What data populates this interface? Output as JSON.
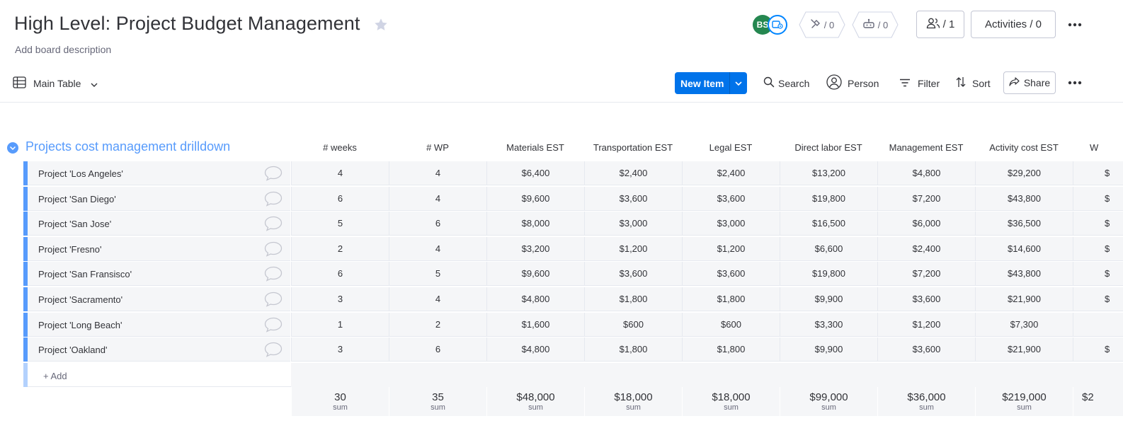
{
  "board": {
    "title": "High Level: Project Budget Management",
    "description": "Add board description"
  },
  "header": {
    "avatar_initials": "BS",
    "integrations_count": "/ 0",
    "automations_count": "/ 0",
    "members_label": "/ 1",
    "activities_label": "Activities / 0"
  },
  "toolbar": {
    "view_label": "Main Table",
    "new_item_label": "New Item",
    "search_label": "Search",
    "person_label": "Person",
    "filter_label": "Filter",
    "sort_label": "Sort",
    "share_label": "Share"
  },
  "group": {
    "title": "Projects cost management drilldown",
    "add_label": "+ Add",
    "sum_label": "sum"
  },
  "columns": [
    "# weeks",
    "# WP",
    "Materials EST",
    "Transportation EST",
    "Legal EST",
    "Direct labor EST",
    "Management EST",
    "Activity cost EST",
    "W"
  ],
  "rows": [
    {
      "name": "Project 'Los Angeles'",
      "cells": [
        "4",
        "4",
        "$6,400",
        "$2,400",
        "$2,400",
        "$13,200",
        "$4,800",
        "$29,200",
        "$"
      ]
    },
    {
      "name": "Project 'San Diego'",
      "cells": [
        "6",
        "4",
        "$9,600",
        "$3,600",
        "$3,600",
        "$19,800",
        "$7,200",
        "$43,800",
        "$"
      ]
    },
    {
      "name": "Project 'San Jose'",
      "cells": [
        "5",
        "6",
        "$8,000",
        "$3,000",
        "$3,000",
        "$16,500",
        "$6,000",
        "$36,500",
        "$"
      ]
    },
    {
      "name": "Project 'Fresno'",
      "cells": [
        "2",
        "4",
        "$3,200",
        "$1,200",
        "$1,200",
        "$6,600",
        "$2,400",
        "$14,600",
        "$"
      ]
    },
    {
      "name": "Project 'San Fransisco'",
      "cells": [
        "6",
        "5",
        "$9,600",
        "$3,600",
        "$3,600",
        "$19,800",
        "$7,200",
        "$43,800",
        "$"
      ]
    },
    {
      "name": "Project 'Sacramento'",
      "cells": [
        "3",
        "4",
        "$4,800",
        "$1,800",
        "$1,800",
        "$9,900",
        "$3,600",
        "$21,900",
        "$"
      ]
    },
    {
      "name": "Project 'Long Beach'",
      "cells": [
        "1",
        "2",
        "$1,600",
        "$600",
        "$600",
        "$3,300",
        "$1,200",
        "$7,300",
        ""
      ]
    },
    {
      "name": "Project 'Oakland'",
      "cells": [
        "3",
        "6",
        "$4,800",
        "$1,800",
        "$1,800",
        "$9,900",
        "$3,600",
        "$21,900",
        "$"
      ]
    }
  ],
  "sums": [
    "30",
    "35",
    "$48,000",
    "$18,000",
    "$18,000",
    "$99,000",
    "$36,000",
    "$219,000",
    "$2"
  ],
  "colors": {
    "group": "#579bfc",
    "primary": "#0073ea",
    "avatar": "#258750"
  }
}
